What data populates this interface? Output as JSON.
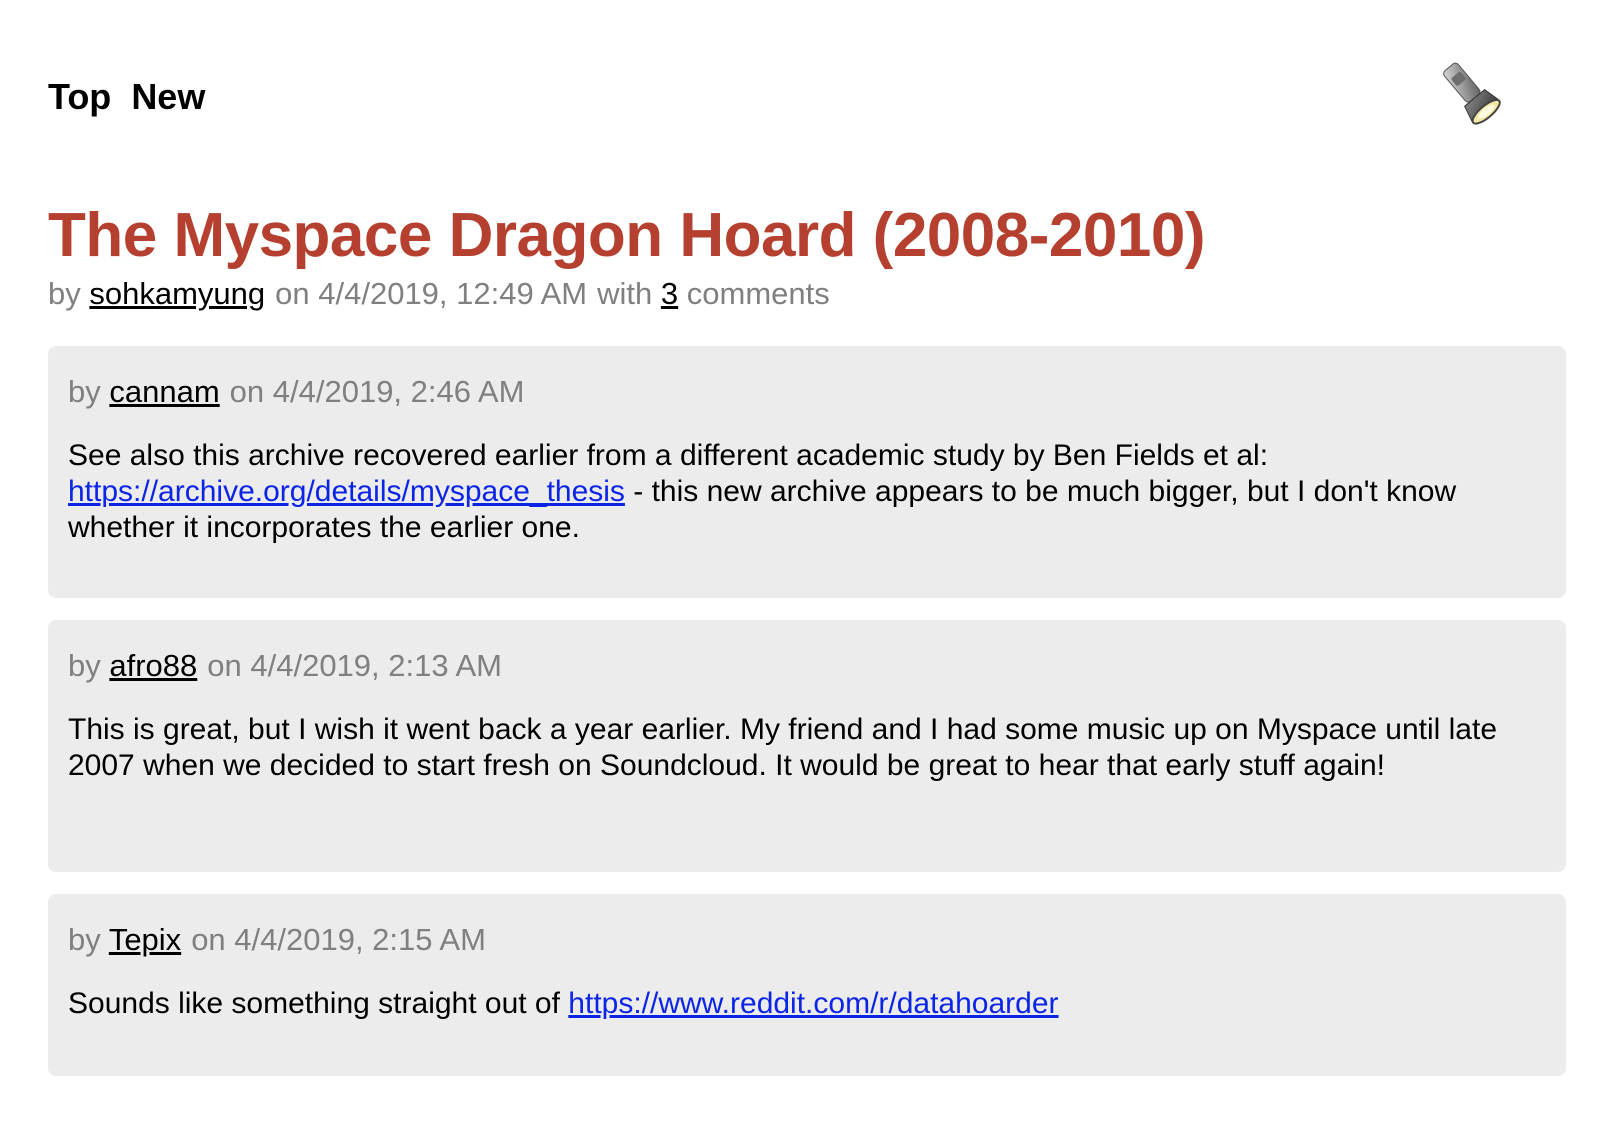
{
  "nav": {
    "top_label": "Top",
    "new_label": "New",
    "icon": "flashlight-icon"
  },
  "story": {
    "title": "The Myspace Dragon Hoard (2008-2010)",
    "by_prefix": "by",
    "author": "sohkamyung",
    "date": "on 4/4/2019, 12:49 AM",
    "with_prefix": "with",
    "comment_count": "3",
    "comments_suffix": "comments"
  },
  "comments": [
    {
      "by_prefix": "by",
      "author": "cannam",
      "date": "on 4/4/2019, 2:46 AM",
      "text_before": "See also this archive recovered earlier from a different academic study by Ben Fields et al: ",
      "link": "https://archive.org/details/myspace_thesis",
      "text_after": " - this new archive appears to be much bigger, but I don't know whether it incorporates the earlier one."
    },
    {
      "by_prefix": "by",
      "author": "afro88",
      "date": "on 4/4/2019, 2:13 AM",
      "text": "This is great, but I wish it went back a year earlier. My friend and I had some music up on Myspace until late 2007 when we decided to start fresh on Soundcloud. It would be great to hear that early stuff again!"
    },
    {
      "by_prefix": "by",
      "author": "Tepix",
      "date": "on 4/4/2019, 2:15 AM",
      "text_before": "Sounds like something straight out of ",
      "link": "https://www.reddit.com/r/datahoarder"
    }
  ],
  "colors": {
    "title": "#b5402f",
    "meta": "#808080",
    "comment_bg": "#ececec",
    "link": "#0b24e6"
  }
}
